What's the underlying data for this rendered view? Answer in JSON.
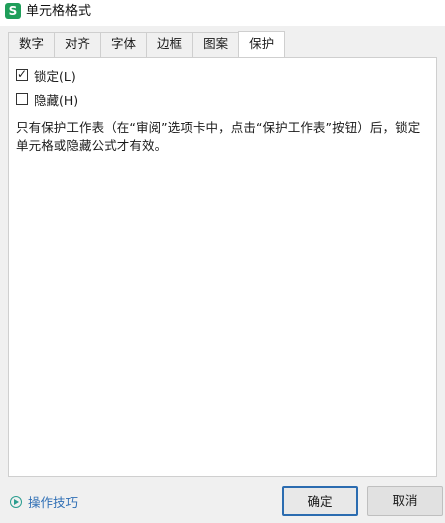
{
  "window": {
    "title": "单元格格式",
    "logo_letter": "S",
    "logo_color": "#1f9e5a"
  },
  "tabs": [
    {
      "label": "数字"
    },
    {
      "label": "对齐"
    },
    {
      "label": "字体"
    },
    {
      "label": "边框"
    },
    {
      "label": "图案"
    },
    {
      "label": "保护",
      "active": true
    }
  ],
  "protection": {
    "locked": {
      "label": "锁定(L)",
      "checked": true,
      "mark": "✓"
    },
    "hidden": {
      "label": "隐藏(H)",
      "checked": false
    },
    "note": "只有保护工作表（在“审阅”选项卡中，点击“保护工作表”按钮）后，锁定单元格或隐藏公式才有效。"
  },
  "footer": {
    "help_link": "操作技巧",
    "ok_label": "确定",
    "cancel_label": "取消"
  },
  "colors": {
    "link": "#2f6fb5",
    "primary_border": "#2b6cb0"
  }
}
